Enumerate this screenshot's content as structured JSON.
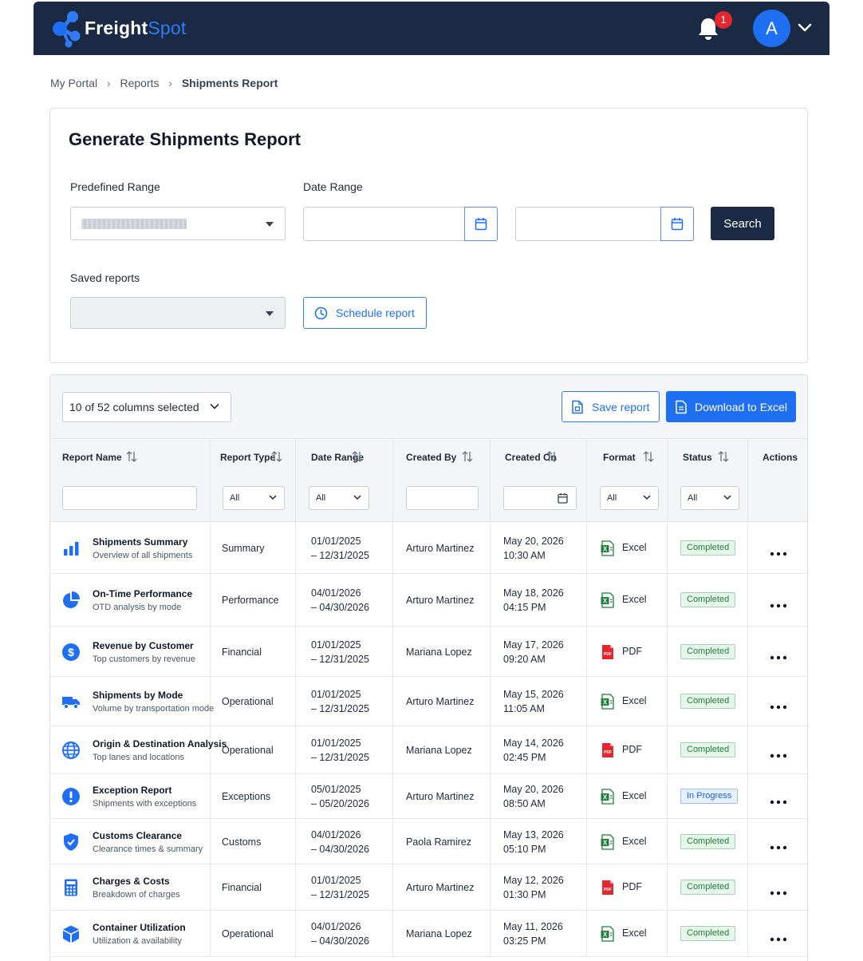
{
  "brand": {
    "name_main": "Freight",
    "name_accent": "Spot",
    "accent_color": "#2f7cf6",
    "header_color": "#1b2a44"
  },
  "header": {
    "notifications_count": "1",
    "avatar_initial": "A"
  },
  "breadcrumb": [
    "My Portal",
    "Reports",
    "Shipments Report"
  ],
  "generate": {
    "title": "Generate Shipments Report",
    "predefined_range_label": "Predefined Range",
    "date_range_label": "Date Range",
    "search_label": "Search",
    "saved_reports_label": "Saved reports",
    "schedule_label": "Schedule report",
    "start_date": "",
    "end_date": ""
  },
  "toolbar": {
    "columns_selected": "10 of 52 columns selected",
    "save_label": "Save report",
    "download_label": "Download to Excel"
  },
  "columns": [
    "Report Name",
    "Report Type",
    "Date Range",
    "Created By",
    "Created On",
    "Format",
    "Status",
    "Actions"
  ],
  "filters": {
    "report_type": "All",
    "date_range": "All",
    "format": "All",
    "status": "All"
  },
  "rows": [
    {
      "icon": "bar-chart-icon",
      "name": "Shipments Summary",
      "desc": "Overview of all shipments",
      "type": "Summary",
      "range_start": "01/01/2025",
      "range_end": "– 12/31/2025",
      "created_by": "Arturo Martinez",
      "created_date": "May 20, 2026",
      "created_time": "10:30 AM",
      "format": "Excel",
      "status": "Completed"
    },
    {
      "icon": "pie-chart-icon",
      "name": "On-Time Performance",
      "desc": "OTD analysis by mode",
      "type": "Performance",
      "range_start": "04/01/2026",
      "range_end": "– 04/30/2026",
      "created_by": "Arturo Martinez",
      "created_date": "May 18, 2026",
      "created_time": "04:15 PM",
      "format": "Excel",
      "status": "Completed"
    },
    {
      "icon": "dollar-icon",
      "name": "Revenue by Customer",
      "desc": "Top customers by revenue",
      "type": "Financial",
      "range_start": "01/01/2025",
      "range_end": "– 12/31/2025",
      "created_by": "Mariana Lopez",
      "created_date": "May 17, 2026",
      "created_time": "09:20 AM",
      "format": "PDF",
      "status": "Completed"
    },
    {
      "icon": "truck-icon",
      "name": "Shipments by Mode",
      "desc": "Volume by transportation mode",
      "type": "Operational",
      "range_start": "01/01/2025",
      "range_end": "– 12/31/2025",
      "created_by": "Arturo Martinez",
      "created_date": "May 15, 2026",
      "created_time": "11:05 AM",
      "format": "Excel",
      "status": "Completed"
    },
    {
      "icon": "globe-icon",
      "name": "Origin & Destination Analysis",
      "desc": "Top lanes and locations",
      "type": "Operational",
      "range_start": "01/01/2025",
      "range_end": "– 12/31/2025",
      "created_by": "Mariana Lopez",
      "created_date": "May 14, 2026",
      "created_time": "02:45 PM",
      "format": "PDF",
      "status": "Completed"
    },
    {
      "icon": "exclamation-icon",
      "name": "Exception Report",
      "desc": "Shipments with exceptions",
      "type": "Exceptions",
      "range_start": "05/01/2025",
      "range_end": "– 05/20/2026",
      "created_by": "Arturo Martinez",
      "created_date": "May 20, 2026",
      "created_time": "08:50 AM",
      "format": "Excel",
      "status": "In Progress"
    },
    {
      "icon": "shield-icon",
      "name": "Customs Clearance",
      "desc": "Clearance times & summary",
      "type": "Customs",
      "range_start": "04/01/2026",
      "range_end": "– 04/30/2026",
      "created_by": "Paola Ramirez",
      "created_date": "May 13, 2026",
      "created_time": "05:10 PM",
      "format": "Excel",
      "status": "Completed"
    },
    {
      "icon": "calculator-icon",
      "name": "Charges & Costs",
      "desc": "Breakdown of charges",
      "type": "Financial",
      "range_start": "01/01/2025",
      "range_end": "– 12/31/2025",
      "created_by": "Arturo Martinez",
      "created_date": "May 12, 2026",
      "created_time": "01:30 PM",
      "format": "PDF",
      "status": "Completed"
    },
    {
      "icon": "cube-icon",
      "name": "Container Utilization",
      "desc": "Utilization & availability",
      "type": "Operational",
      "range_start": "04/01/2026",
      "range_end": "– 04/30/2026",
      "created_by": "Mariana Lopez",
      "created_date": "May 11, 2026",
      "created_time": "03:25 PM",
      "format": "Excel",
      "status": "Completed"
    }
  ]
}
